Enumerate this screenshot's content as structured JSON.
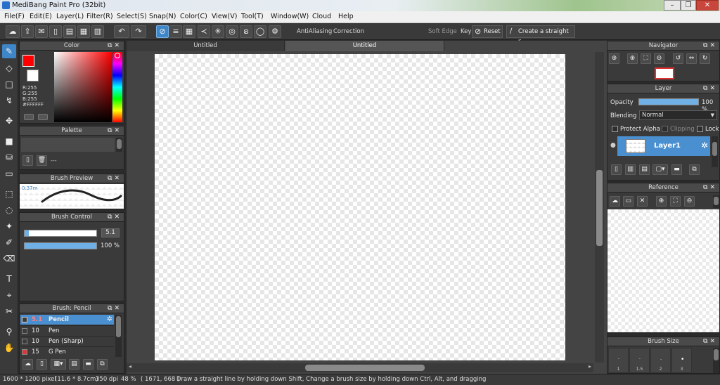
{
  "window": {
    "title": "MediBang Paint Pro (32bit)",
    "minimize": "–",
    "restore": "❐",
    "close": "✕"
  },
  "menu": [
    "File(F)",
    "Edit(E)",
    "Layer(L)",
    "Filter(R)",
    "Select(S)",
    "Snap(N)",
    "Color(C)",
    "View(V)",
    "Tool(T)",
    "Window(W)",
    "Cloud",
    "Help"
  ],
  "toolbar": {
    "antialiasing_label": "AntiAliasing",
    "correction_label": "Correction",
    "correction_value": "0",
    "soft_edge_label": "Soft Edge",
    "key_label": "Key",
    "reset_label": "Reset",
    "straight_line_label": "Create a straight line"
  },
  "color_panel": {
    "title": "Color",
    "rgb": [
      "R:255",
      "G:255",
      "B:255"
    ],
    "hex": "#FFFFFF"
  },
  "palette_panel": {
    "title": "Palette",
    "dash": "---"
  },
  "brush_preview": {
    "title": "Brush Preview",
    "size": "0.37m"
  },
  "brush_control": {
    "title": "Brush Control",
    "size_value": "5.1",
    "opacity_value": "100 %"
  },
  "brush_list": {
    "title": "Brush: Pencil",
    "items": [
      {
        "size": "5.1",
        "name": "Pencil",
        "color": "#3a3a3a"
      },
      {
        "size": "10",
        "name": "Pen",
        "color": "#3a3a3a"
      },
      {
        "size": "10",
        "name": "Pen (Sharp)",
        "color": "#3a3a3a"
      },
      {
        "size": "15",
        "name": "G Pen",
        "color": "#d63a3a"
      }
    ]
  },
  "tabs": [
    "Untitled",
    "Untitled"
  ],
  "navigator": {
    "title": "Navigator"
  },
  "layer_panel": {
    "title": "Layer",
    "opacity_label": "Opacity",
    "opacity_value": "100 %",
    "blending_label": "Blending",
    "blending_value": "Normal",
    "protect_alpha": "Protect Alpha",
    "clipping": "Clipping",
    "lock": "Lock",
    "layer_name": "Layer1"
  },
  "reference_panel": {
    "title": "Reference"
  },
  "brush_size_panel": {
    "title": "Brush Size",
    "sizes": [
      "1",
      "1.5",
      "2",
      "3"
    ]
  },
  "status": {
    "dimensions": "1600 * 1200 pixel",
    "physical": "(11.6 * 8.7cm)",
    "dpi": "350 dpi",
    "zoom": "48 %",
    "coords": "( 1671, 668 )",
    "hint": "Draw a straight line by holding down Shift, Change a brush size by holding down Ctrl, Alt, and dragging"
  },
  "colors": {
    "accent": "#3f86c8",
    "foreground_swatch": "#ff0000",
    "background_swatch": "#ffffff"
  }
}
